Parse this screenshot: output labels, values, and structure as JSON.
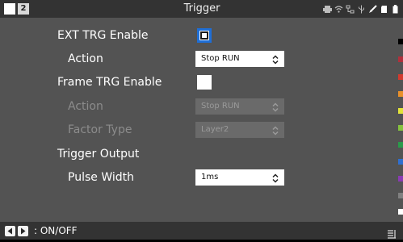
{
  "header": {
    "title": "Trigger",
    "badge": "2"
  },
  "status_icons": [
    "printer-icon",
    "wifi-icon",
    "network-icon",
    "usb-icon",
    "brush-icon",
    "card-icon",
    "battery-icon"
  ],
  "rows": {
    "ext_trg_enable": {
      "label": "EXT TRG Enable",
      "checked": false,
      "focused": true
    },
    "action1": {
      "label": "Action",
      "value": "Stop RUN"
    },
    "frame_trg_enable": {
      "label": "Frame TRG Enable",
      "checked": false
    },
    "action2": {
      "label": "Action",
      "value": "Stop RUN",
      "disabled": true
    },
    "factor_type": {
      "label": "Factor Type",
      "value": "Layer2",
      "disabled": true
    },
    "trigger_output": {
      "label": "Trigger Output"
    },
    "pulse_width": {
      "label": "Pulse Width",
      "value": "1ms"
    }
  },
  "footer": {
    "hint": ": ON/OFF"
  },
  "strip_colors": [
    "#000000",
    "#b0303c",
    "#d23a2e",
    "#e8902a",
    "#e3e33a",
    "#86c23e",
    "#2a9a4a",
    "#2f6fd0",
    "#8a3bb3",
    "#808080",
    "#ffffff"
  ]
}
